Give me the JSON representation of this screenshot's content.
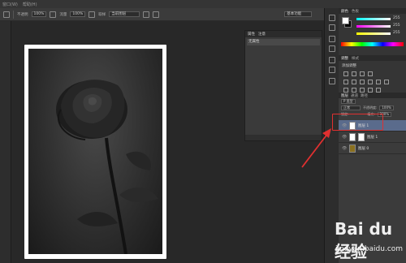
{
  "menubar": {
    "items": [
      "窗口(W)",
      "帮助(H)"
    ]
  },
  "options": {
    "opacity_label": "不透明",
    "opacity_value": "100%",
    "flow_label": "流量",
    "flow_value": "100%",
    "sample_label": "取样",
    "sample_value": "当前图层",
    "reset_label": "基本功能"
  },
  "float_panel": {
    "tabs": [
      "属性",
      "注意"
    ],
    "row": "无属性"
  },
  "color_panel": {
    "tabs": [
      "颜色",
      "色板"
    ],
    "r": "255",
    "g": "255",
    "b": "255",
    "colors": {
      "fg": "#ffffff",
      "bg": "#000000"
    }
  },
  "adjust_panel": {
    "tabs": [
      "调整",
      "样式"
    ],
    "title": "添加调整"
  },
  "layers_panel": {
    "tabs": [
      "图层",
      "通道",
      "路径"
    ],
    "kind_label": "P 类型",
    "mode_value": "正常",
    "opacity_label": "不透明度:",
    "opacity_value": "100%",
    "lock_label": "锁定:",
    "fill_label": "填充:",
    "fill_value": "100%",
    "layers": [
      {
        "name": "图层 1",
        "selected": true
      },
      {
        "name": "图层 1",
        "selected": false
      },
      {
        "name": "图层 0",
        "selected": false
      }
    ]
  },
  "annotation": {
    "color": "#e03030"
  },
  "watermark": {
    "brand": "Bai du 经验",
    "url": "jingyan.baidu.com"
  }
}
